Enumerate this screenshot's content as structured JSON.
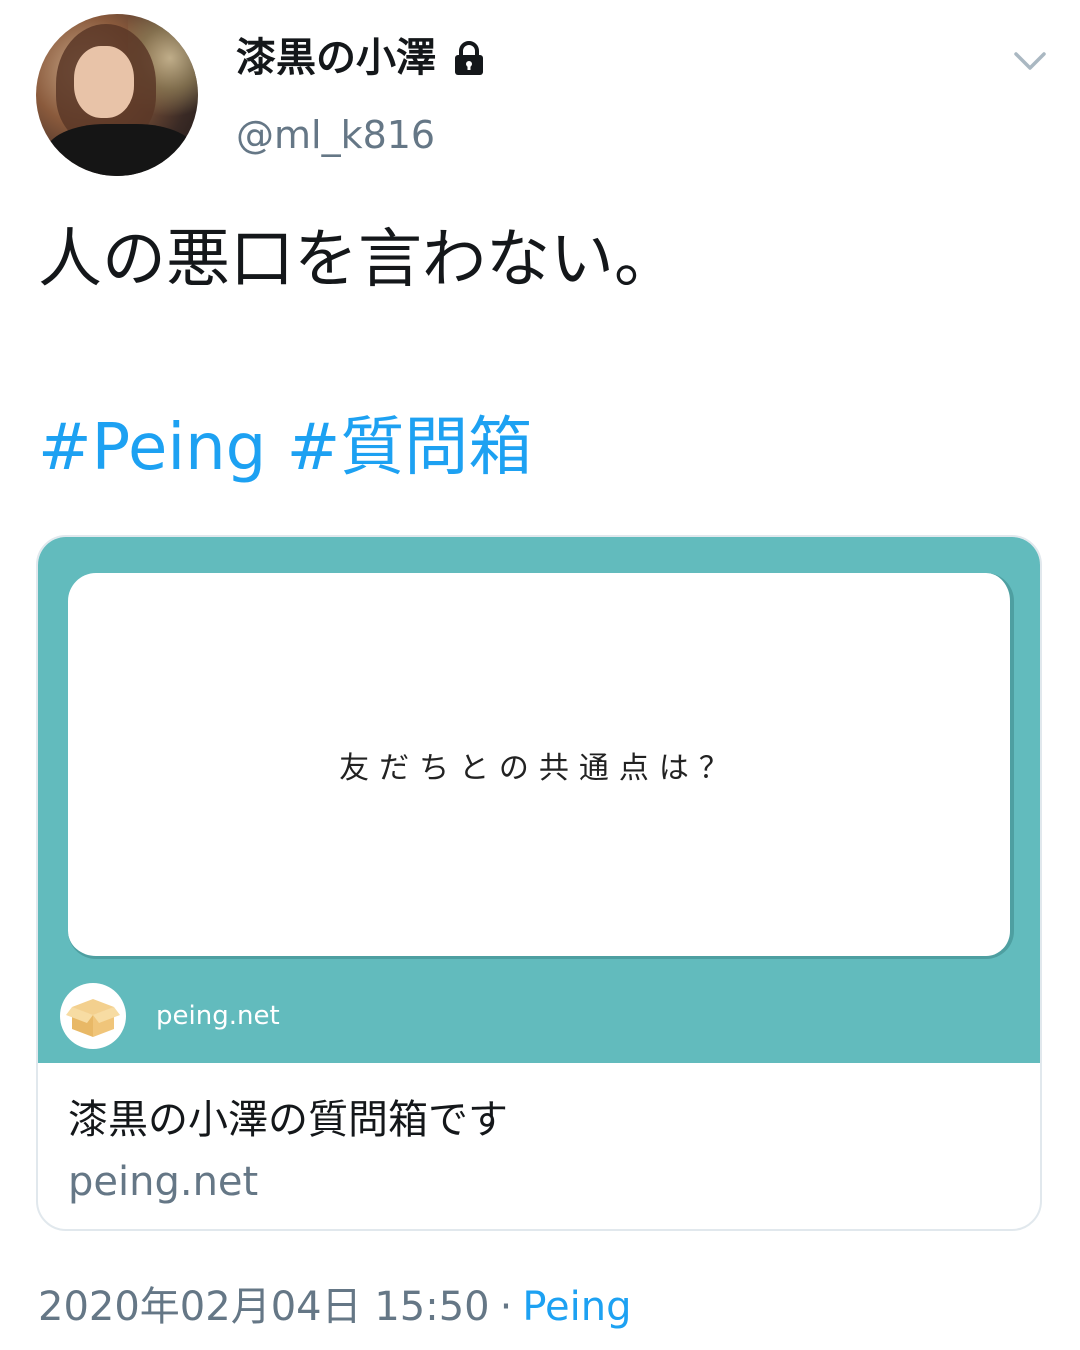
{
  "tweet": {
    "author": {
      "display_name": "漆黒の小澤",
      "handle": "@ml_k816",
      "protected_icon": "lock-icon",
      "avatar_icon": "profile-photo"
    },
    "menu_icon": "chevron-down-icon",
    "text": "人の悪口を言わない。",
    "hashtags": [
      "#Peing",
      "#質問箱"
    ],
    "card": {
      "image_question": "友だちとの共通点は？",
      "image_domain": "peing.net",
      "logo_icon": "box-icon",
      "title": "漆黒の小澤の質問箱です",
      "domain": "peing.net",
      "colors": {
        "card_bg": "#62bbbd",
        "box_bg": "#ffffff"
      }
    },
    "meta": {
      "date": "2020年02月04日",
      "time": "15:50",
      "separator": "·",
      "source": "Peing"
    }
  },
  "colors": {
    "link": "#1da1f2",
    "secondary_text": "#657786",
    "primary_text": "#14171a"
  }
}
